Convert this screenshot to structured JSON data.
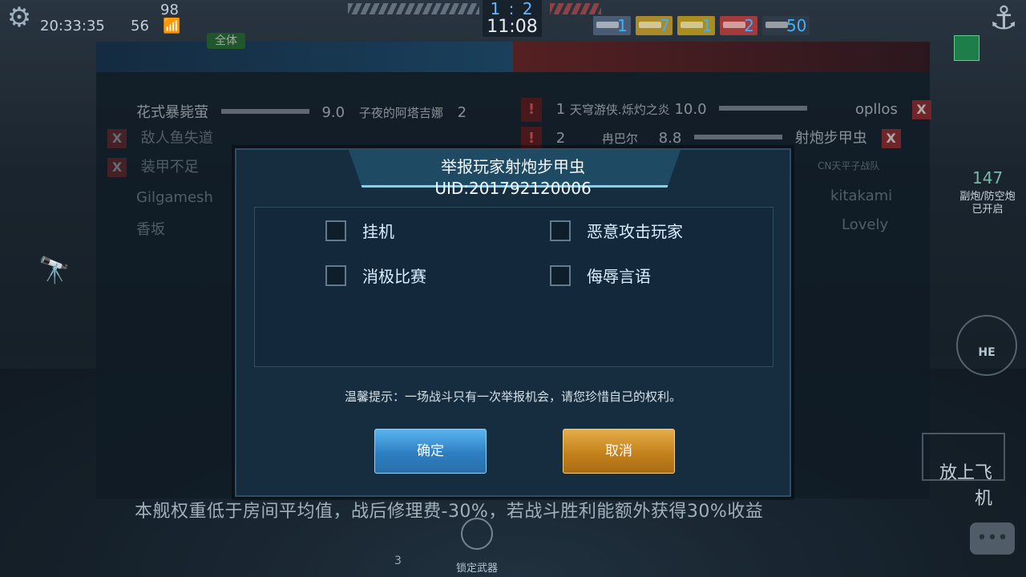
{
  "hud": {
    "clock": "20:33:35",
    "ping": "56",
    "fps": "98",
    "score": "1 : 2",
    "timer": "11:08",
    "ship_counts": [
      "1",
      "7",
      "1",
      "2",
      "50"
    ],
    "ammo_count": "147",
    "ammo_label_line1": "副炮/防空炮",
    "ammo_label_line2": "已开启",
    "shell_type": "HE",
    "launch_plane_label": "放上飞机",
    "lock_weapon_label": "锁定武器",
    "speed_gear": "3",
    "bottom_notice": "本舰权重低于房间平均值，战后修理费-30%，若战斗胜利能额外获得30%收益"
  },
  "scoreboard": {
    "tab_all": "全体",
    "left_rows": [
      {
        "name": "花式暴毙萤",
        "score": "9.0",
        "ship": "子夜的阿塔吉娜",
        "rank": "2"
      },
      {
        "name": "敌人鱼失道",
        "score": "",
        "ship": "",
        "rank": ""
      },
      {
        "name": "装甲不足",
        "score": "",
        "ship": "",
        "rank": ""
      },
      {
        "name": "Gilgamesh",
        "score": "",
        "ship": "",
        "rank": ""
      },
      {
        "name": "香坂",
        "score": "",
        "ship": "",
        "rank": ""
      }
    ],
    "right_rows": [
      {
        "rank": "1",
        "ship": "天穹游侠.烁灼之炎",
        "score": "10.0",
        "name": "opllos"
      },
      {
        "rank": "2",
        "ship": "冉巴尔",
        "score": "8.8",
        "name": "射炮步甲虫"
      },
      {
        "rank": "",
        "ship": "",
        "score": "",
        "name": "CN天平子战队"
      },
      {
        "rank": "",
        "ship": "",
        "score": "",
        "name": "kitakami"
      },
      {
        "rank": "",
        "ship": "",
        "score": "",
        "name": "Lovely"
      }
    ]
  },
  "report_dialog": {
    "title": "举报玩家射炮步甲虫",
    "uid": "UID:201792120006",
    "options": [
      {
        "label": "挂机",
        "checked": false
      },
      {
        "label": "恶意攻击玩家",
        "checked": false
      },
      {
        "label": "消极比赛",
        "checked": false
      },
      {
        "label": "侮辱言语",
        "checked": false
      }
    ],
    "tip": "温馨提示：一场战斗只有一次举报机会，请您珍惜自己的权利。",
    "confirm_label": "确定",
    "cancel_label": "取消"
  },
  "colors": {
    "confirm_button": "#2d7fc2",
    "cancel_button": "#c4821c",
    "score_blue": "#64b6ff"
  }
}
